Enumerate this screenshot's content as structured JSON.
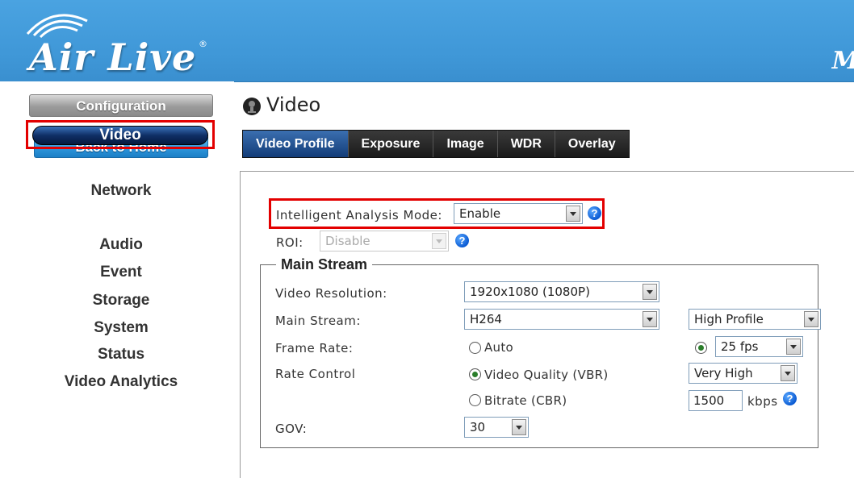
{
  "header": {
    "logo_text": "Air Live",
    "logo_mark": "®",
    "right_text": "M",
    "brand_color": "#3f97d7"
  },
  "sidebar": {
    "config_label": "Configuration",
    "home_label": "Back to Home",
    "nav_items": [
      {
        "label": "Network"
      },
      {
        "label": "Video",
        "active": true
      },
      {
        "label": "Audio"
      },
      {
        "label": "Event"
      },
      {
        "label": "Storage"
      },
      {
        "label": "System"
      },
      {
        "label": "Status"
      },
      {
        "label": "Video Analytics"
      }
    ]
  },
  "page": {
    "title": "Video",
    "icon": "camera-icon"
  },
  "tabs": [
    {
      "label": "Video Profile",
      "active": true
    },
    {
      "label": "Exposure"
    },
    {
      "label": "Image"
    },
    {
      "label": "WDR"
    },
    {
      "label": "Overlay"
    }
  ],
  "form": {
    "ia_mode_label": "Intelligent Analysis Mode:",
    "ia_mode_value": "Enable",
    "roi_label": "ROI:",
    "roi_value": "Disable",
    "help_glyph": "?",
    "main_stream": {
      "legend": "Main Stream",
      "resolution_label": "Video Resolution:",
      "resolution_value": "1920x1080 (1080P)",
      "stream_label": "Main Stream:",
      "stream_value": "H264",
      "profile_value": "High Profile",
      "framerate_label": "Frame Rate:",
      "framerate_auto": "Auto",
      "framerate_value": "25 fps",
      "rate_control_label": "Rate Control",
      "vbr_label": "Video Quality (VBR)",
      "quality_value": "Very High",
      "cbr_label": "Bitrate (CBR)",
      "bitrate_value": "1500",
      "bitrate_unit": "kbps",
      "gov_label": "GOV:",
      "gov_value": "30"
    }
  }
}
